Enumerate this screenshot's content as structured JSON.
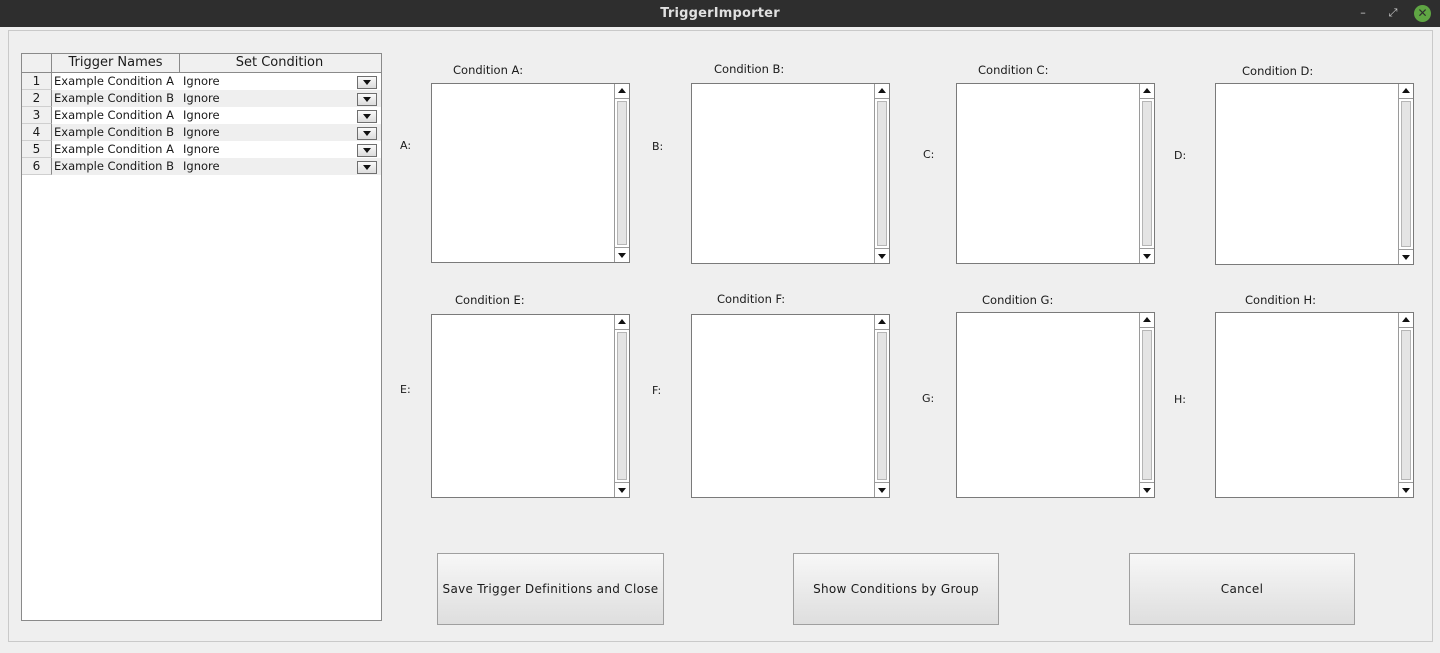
{
  "window": {
    "title": "TriggerImporter",
    "minimize_glyph": "–",
    "maximize_glyph": "⤢",
    "close_glyph": "✕"
  },
  "table": {
    "headers": [
      "",
      "Trigger Names",
      "Set Condition"
    ],
    "rows": [
      {
        "num": "1",
        "name": "Example Condition A",
        "condition": "Ignore"
      },
      {
        "num": "2",
        "name": "Example Condition B",
        "condition": "Ignore"
      },
      {
        "num": "3",
        "name": "Example Condition A",
        "condition": "Ignore"
      },
      {
        "num": "4",
        "name": "Example Condition B",
        "condition": "Ignore"
      },
      {
        "num": "5",
        "name": "Example Condition A",
        "condition": "Ignore"
      },
      {
        "num": "6",
        "name": "Example Condition B",
        "condition": "Ignore"
      }
    ]
  },
  "conditions": [
    {
      "key": "A:",
      "title": "Condition A:"
    },
    {
      "key": "B:",
      "title": "Condition B:"
    },
    {
      "key": "C:",
      "title": "Condition C:"
    },
    {
      "key": "D:",
      "title": "Condition D:"
    },
    {
      "key": "E:",
      "title": "Condition E:"
    },
    {
      "key": "F:",
      "title": "Condition F:"
    },
    {
      "key": "G:",
      "title": "Condition G:"
    },
    {
      "key": "H:",
      "title": "Condition H:"
    }
  ],
  "buttons": {
    "save": "Save Trigger Definitions and Close",
    "show_groups": "Show Conditions by Group",
    "cancel": "Cancel"
  }
}
